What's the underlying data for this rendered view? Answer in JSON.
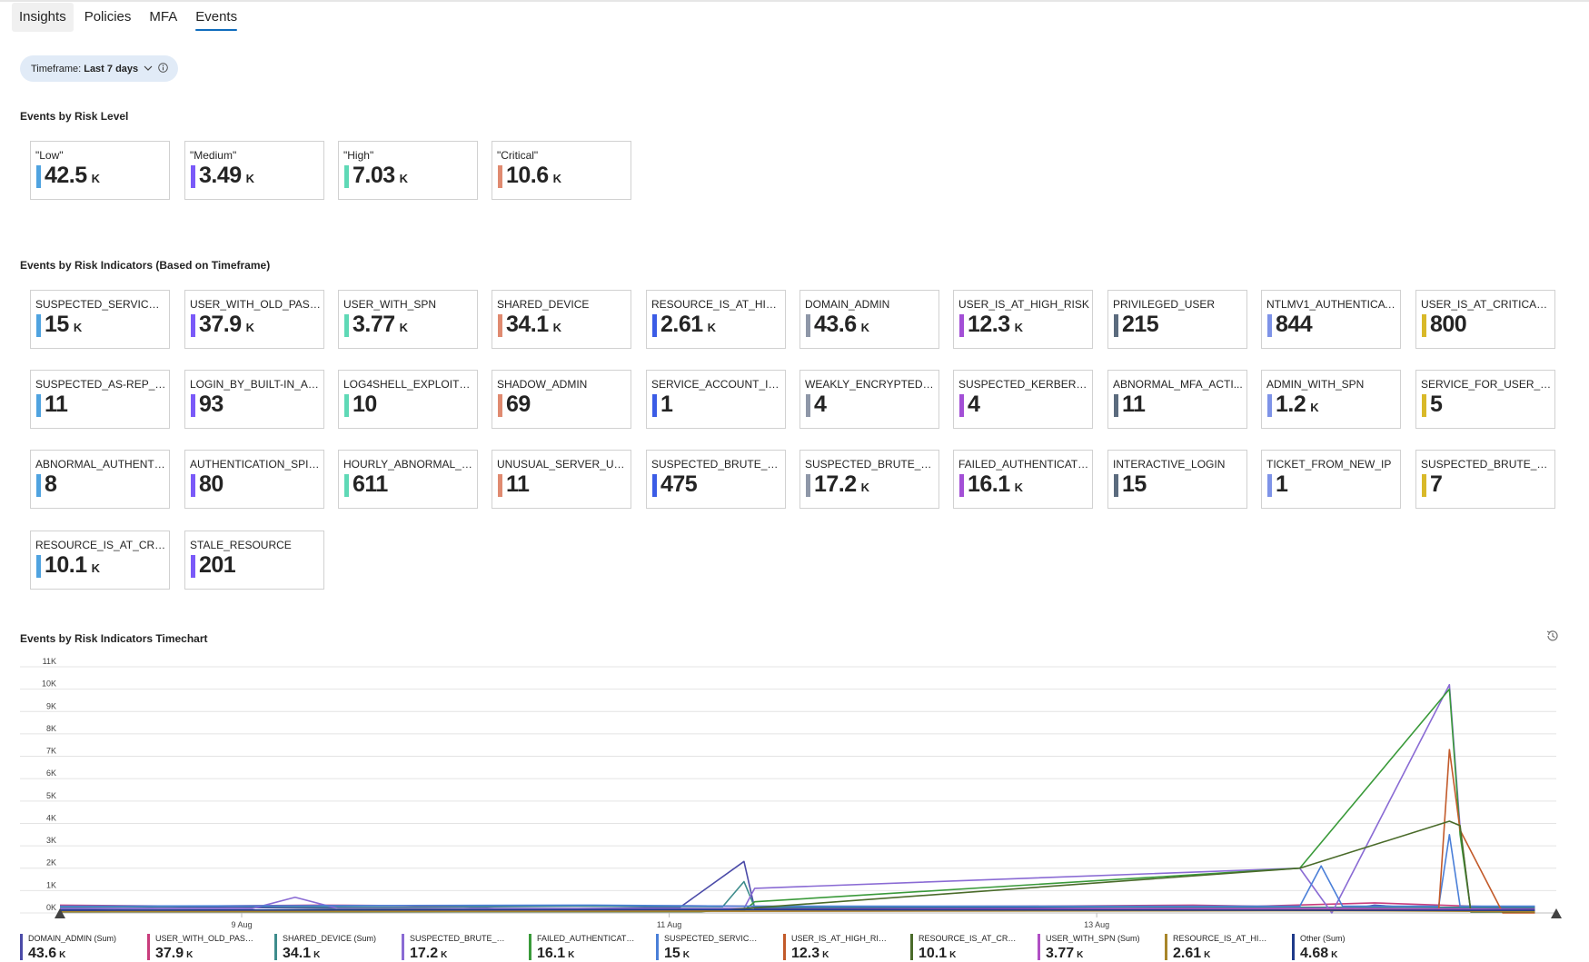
{
  "tabs": [
    {
      "label": "Insights"
    },
    {
      "label": "Policies"
    },
    {
      "label": "MFA"
    },
    {
      "label": "Events"
    }
  ],
  "timeframe": {
    "prefix": "Timeframe:",
    "value": "Last 7 days"
  },
  "sections": {
    "risk_level": "Events by Risk Level",
    "risk_indicators": "Events by Risk Indicators (Based on Timeframe)",
    "timechart": "Events by Risk Indicators Timechart"
  },
  "risk_level_cards": [
    {
      "label": "\"Low\"",
      "value": "42.5",
      "unit": "K",
      "color": "#4fa3e0"
    },
    {
      "label": "\"Medium\"",
      "value": "3.49",
      "unit": "K",
      "color": "#7a5af8"
    },
    {
      "label": "\"High\"",
      "value": "7.03",
      "unit": "K",
      "color": "#5fd9b6"
    },
    {
      "label": "\"Critical\"",
      "value": "10.6",
      "unit": "K",
      "color": "#e08a70"
    }
  ],
  "indicator_cards": [
    {
      "label": "SUSPECTED_SERVICE_A...",
      "value": "15",
      "unit": "K",
      "color": "#4fa3e0"
    },
    {
      "label": "USER_WITH_OLD_PASS...",
      "value": "37.9",
      "unit": "K",
      "color": "#7a5af8"
    },
    {
      "label": "USER_WITH_SPN",
      "value": "3.77",
      "unit": "K",
      "color": "#5fd9b6"
    },
    {
      "label": "SHARED_DEVICE",
      "value": "34.1",
      "unit": "K",
      "color": "#e08a70"
    },
    {
      "label": "RESOURCE_IS_AT_HIGH...",
      "value": "2.61",
      "unit": "K",
      "color": "#3b5ce6"
    },
    {
      "label": "DOMAIN_ADMIN",
      "value": "43.6",
      "unit": "K",
      "color": "#8e97a8"
    },
    {
      "label": "USER_IS_AT_HIGH_RISK",
      "value": "12.3",
      "unit": "K",
      "color": "#a34fd6"
    },
    {
      "label": "PRIVILEGED_USER",
      "value": "215",
      "unit": "",
      "color": "#5b6b7e"
    },
    {
      "label": "NTLMV1_AUTHENTICAT...",
      "value": "844",
      "unit": "",
      "color": "#7e93e8"
    },
    {
      "label": "USER_IS_AT_CRITICAL_R...",
      "value": "800",
      "unit": "",
      "color": "#d9b929"
    },
    {
      "label": "SUSPECTED_AS-REP_RO...",
      "value": "11",
      "unit": "",
      "color": "#4fa3e0"
    },
    {
      "label": "LOGIN_BY_BUILT-IN_AD...",
      "value": "93",
      "unit": "",
      "color": "#7a5af8"
    },
    {
      "label": "LOG4SHELL_EXPLOIT_A...",
      "value": "10",
      "unit": "",
      "color": "#5fd9b6"
    },
    {
      "label": "SHADOW_ADMIN",
      "value": "69",
      "unit": "",
      "color": "#e08a70"
    },
    {
      "label": "SERVICE_ACCOUNT_INT...",
      "value": "1",
      "unit": "",
      "color": "#3b5ce6"
    },
    {
      "label": "WEAKLY_ENCRYPTED_R...",
      "value": "4",
      "unit": "",
      "color": "#8e97a8"
    },
    {
      "label": "SUSPECTED_KERBEROA...",
      "value": "4",
      "unit": "",
      "color": "#a34fd6"
    },
    {
      "label": "ABNORMAL_MFA_ACTI...",
      "value": "11",
      "unit": "",
      "color": "#5b6b7e"
    },
    {
      "label": "ADMIN_WITH_SPN",
      "value": "1.2",
      "unit": "K",
      "color": "#7e93e8"
    },
    {
      "label": "SERVICE_FOR_USER_TO...",
      "value": "5",
      "unit": "",
      "color": "#d9b929"
    },
    {
      "label": "ABNORMAL_AUTHENTI...",
      "value": "8",
      "unit": "",
      "color": "#4fa3e0"
    },
    {
      "label": "AUTHENTICATION_SPIKE",
      "value": "80",
      "unit": "",
      "color": "#7a5af8"
    },
    {
      "label": "HOURLY_ABNORMAL_A...",
      "value": "611",
      "unit": "",
      "color": "#5fd9b6"
    },
    {
      "label": "UNUSUAL_SERVER_USE",
      "value": "11",
      "unit": "",
      "color": "#e08a70"
    },
    {
      "label": "SUSPECTED_BRUTE_FO...",
      "value": "475",
      "unit": "",
      "color": "#3b5ce6"
    },
    {
      "label": "SUSPECTED_BRUTE_FO...",
      "value": "17.2",
      "unit": "K",
      "color": "#8e97a8"
    },
    {
      "label": "FAILED_AUTHENTICATI...",
      "value": "16.1",
      "unit": "K",
      "color": "#a34fd6"
    },
    {
      "label": "INTERACTIVE_LOGIN",
      "value": "15",
      "unit": "",
      "color": "#5b6b7e"
    },
    {
      "label": "TICKET_FROM_NEW_IP",
      "value": "1",
      "unit": "",
      "color": "#7e93e8"
    },
    {
      "label": "SUSPECTED_BRUTE_FO...",
      "value": "7",
      "unit": "",
      "color": "#d9b929"
    },
    {
      "label": "RESOURCE_IS_AT_CRITI...",
      "value": "10.1",
      "unit": "K",
      "color": "#4fa3e0"
    },
    {
      "label": "STALE_RESOURCE",
      "value": "201",
      "unit": "",
      "color": "#7a5af8"
    }
  ],
  "icons": {
    "timeframe_dropdown": "chevron-down-icon",
    "timeframe_info": "info-icon",
    "chart_history": "history-icon"
  },
  "chart_data": {
    "type": "line",
    "title": "Events by Risk Indicators Timechart",
    "x_ticks": [
      "9 Aug",
      "11 Aug",
      "13 Aug"
    ],
    "y_ticks": [
      "11K",
      "10K",
      "9K",
      "8K",
      "7K",
      "6K",
      "5K",
      "4K",
      "3K",
      "2K",
      "1K",
      "0K"
    ],
    "ylim": [
      0,
      11000
    ],
    "x_range_days": [
      0,
      7
    ],
    "grid": true,
    "legend_position": "bottom",
    "series": [
      {
        "name": "DOMAIN_ADMIN (Sum)",
        "total": "43.6",
        "unit": "K",
        "color": "#4b4ba8",
        "points": [
          [
            0,
            150
          ],
          [
            0.7,
            250
          ],
          [
            1.5,
            200
          ],
          [
            1.8,
            330
          ],
          [
            2.1,
            150
          ],
          [
            2.9,
            250
          ],
          [
            3.2,
            2300
          ],
          [
            3.25,
            200
          ],
          [
            4,
            220
          ],
          [
            5,
            250
          ],
          [
            6.05,
            200
          ],
          [
            6.15,
            350
          ],
          [
            6.3,
            250
          ],
          [
            6.9,
            200
          ]
        ]
      },
      {
        "name": "USER_WITH_OLD_PASSW...",
        "total": "37.9",
        "unit": "K",
        "color": "#c93d7c",
        "points": [
          [
            0,
            350
          ],
          [
            0.6,
            300
          ],
          [
            1.2,
            350
          ],
          [
            2,
            300
          ],
          [
            2.9,
            320
          ],
          [
            3.5,
            280
          ],
          [
            4.5,
            300
          ],
          [
            5.3,
            350
          ],
          [
            5.6,
            300
          ],
          [
            6.15,
            450
          ],
          [
            6.6,
            300
          ],
          [
            6.9,
            250
          ]
        ]
      },
      {
        "name": "SHARED_DEVICE (Sum)",
        "total": "34.1",
        "unit": "K",
        "color": "#3e8c8c",
        "points": [
          [
            0,
            250
          ],
          [
            0.8,
            300
          ],
          [
            1.6,
            250
          ],
          [
            2.4,
            300
          ],
          [
            3.1,
            280
          ],
          [
            3.2,
            1400
          ],
          [
            3.25,
            250
          ],
          [
            4.5,
            280
          ],
          [
            6,
            250
          ],
          [
            6.9,
            250
          ]
        ]
      },
      {
        "name": "SUSPECTED_BRUTE_FORC...",
        "total": "17.2",
        "unit": "K",
        "color": "#8a6bd4",
        "points": [
          [
            0,
            200
          ],
          [
            0.9,
            200
          ],
          [
            1.1,
            700
          ],
          [
            1.3,
            200
          ],
          [
            3.2,
            200
          ],
          [
            3.25,
            1100
          ],
          [
            5.8,
            2000
          ],
          [
            5.95,
            0
          ],
          [
            6.5,
            10200
          ],
          [
            6.55,
            3800
          ],
          [
            6.6,
            100
          ],
          [
            6.9,
            100
          ]
        ]
      },
      {
        "name": "FAILED_AUTHENTICATIO...",
        "total": "16.1",
        "unit": "K",
        "color": "#3a9a3a",
        "points": [
          [
            0,
            100
          ],
          [
            1.5,
            150
          ],
          [
            3.2,
            100
          ],
          [
            3.25,
            500
          ],
          [
            5.8,
            2000
          ],
          [
            6.5,
            10000
          ],
          [
            6.55,
            3500
          ],
          [
            6.6,
            100
          ],
          [
            6.9,
            100
          ]
        ]
      },
      {
        "name": "SUSPECTED_SERVICE_AC...",
        "total": "15",
        "unit": "K",
        "color": "#4a7fd8",
        "points": [
          [
            0,
            300
          ],
          [
            2.5,
            350
          ],
          [
            3.2,
            300
          ],
          [
            5.8,
            300
          ],
          [
            5.9,
            2100
          ],
          [
            6,
            300
          ],
          [
            6.45,
            300
          ],
          [
            6.5,
            3500
          ],
          [
            6.55,
            300
          ],
          [
            6.9,
            300
          ]
        ]
      },
      {
        "name": "USER_IS_AT_HIGH_RISK (S...",
        "total": "12.3",
        "unit": "K",
        "color": "#c25a2a",
        "points": [
          [
            0,
            100
          ],
          [
            2,
            100
          ],
          [
            3.2,
            80
          ],
          [
            5,
            100
          ],
          [
            6.45,
            150
          ],
          [
            6.5,
            7300
          ],
          [
            6.55,
            3700
          ],
          [
            6.75,
            0
          ],
          [
            6.9,
            0
          ]
        ]
      },
      {
        "name": "RESOURCE_IS_AT_CRITIC...",
        "total": "10.1",
        "unit": "K",
        "color": "#4a6b2a",
        "points": [
          [
            0,
            50
          ],
          [
            3,
            60
          ],
          [
            5.8,
            2000
          ],
          [
            6.5,
            4100
          ],
          [
            6.55,
            3900
          ],
          [
            6.6,
            50
          ],
          [
            6.9,
            50
          ]
        ]
      },
      {
        "name": "USER_WITH_SPN (Sum)",
        "total": "3.77",
        "unit": "K",
        "color": "#b04fc4",
        "points": [
          [
            0,
            100
          ],
          [
            3,
            150
          ],
          [
            6,
            200
          ],
          [
            6.9,
            150
          ]
        ]
      },
      {
        "name": "RESOURCE_IS_AT_HIGH_R...",
        "total": "2.61",
        "unit": "K",
        "color": "#a8862a",
        "points": [
          [
            0,
            60
          ],
          [
            3,
            80
          ],
          [
            6,
            100
          ],
          [
            6.9,
            60
          ]
        ]
      },
      {
        "name": "Other (Sum)",
        "total": "4.68",
        "unit": "K",
        "color": "#1f3a8a",
        "points": [
          [
            0,
            120
          ],
          [
            3,
            150
          ],
          [
            6,
            120
          ],
          [
            6.9,
            120
          ]
        ]
      }
    ]
  }
}
